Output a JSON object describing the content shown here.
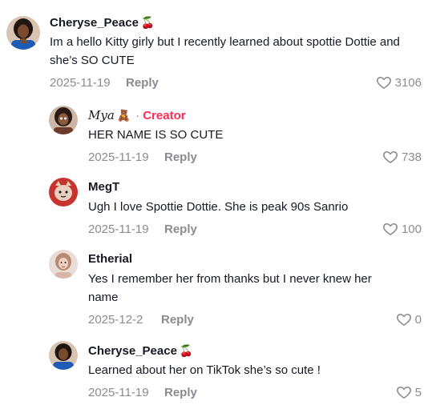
{
  "comments": [
    {
      "username": "Cheryse_Peace",
      "emoji": "🍒",
      "text": "Im a hello Kitty girly but I recently learned about spottie Dottie and she’s SO CUTE",
      "date": "2025-11-19",
      "reply_label": "Reply",
      "likes": "3106"
    },
    {
      "username": "𝑀𝑦𝑎",
      "emoji": "🧸",
      "badge": "Creator",
      "text": "HER NAME IS SO CUTE",
      "date": "2025-11-19",
      "reply_label": "Reply",
      "likes": "738"
    },
    {
      "username": "MegT",
      "text": "Ugh I love Spottie Dottie. She is peak 90s Sanrio",
      "date": "2025-11-19",
      "reply_label": "Reply",
      "likes": "100"
    },
    {
      "username": "Etherial",
      "text": "Yes I remember her from thanks but I never knew her name",
      "date": "2025-12-2",
      "reply_label": "Reply",
      "likes": "0"
    },
    {
      "username": "Cheryse_Peace",
      "emoji": "🍒",
      "text": "Learned about her on TikTok she’s so cute !",
      "date": "2025-11-19",
      "reply_label": "Reply",
      "likes": "5"
    }
  ]
}
